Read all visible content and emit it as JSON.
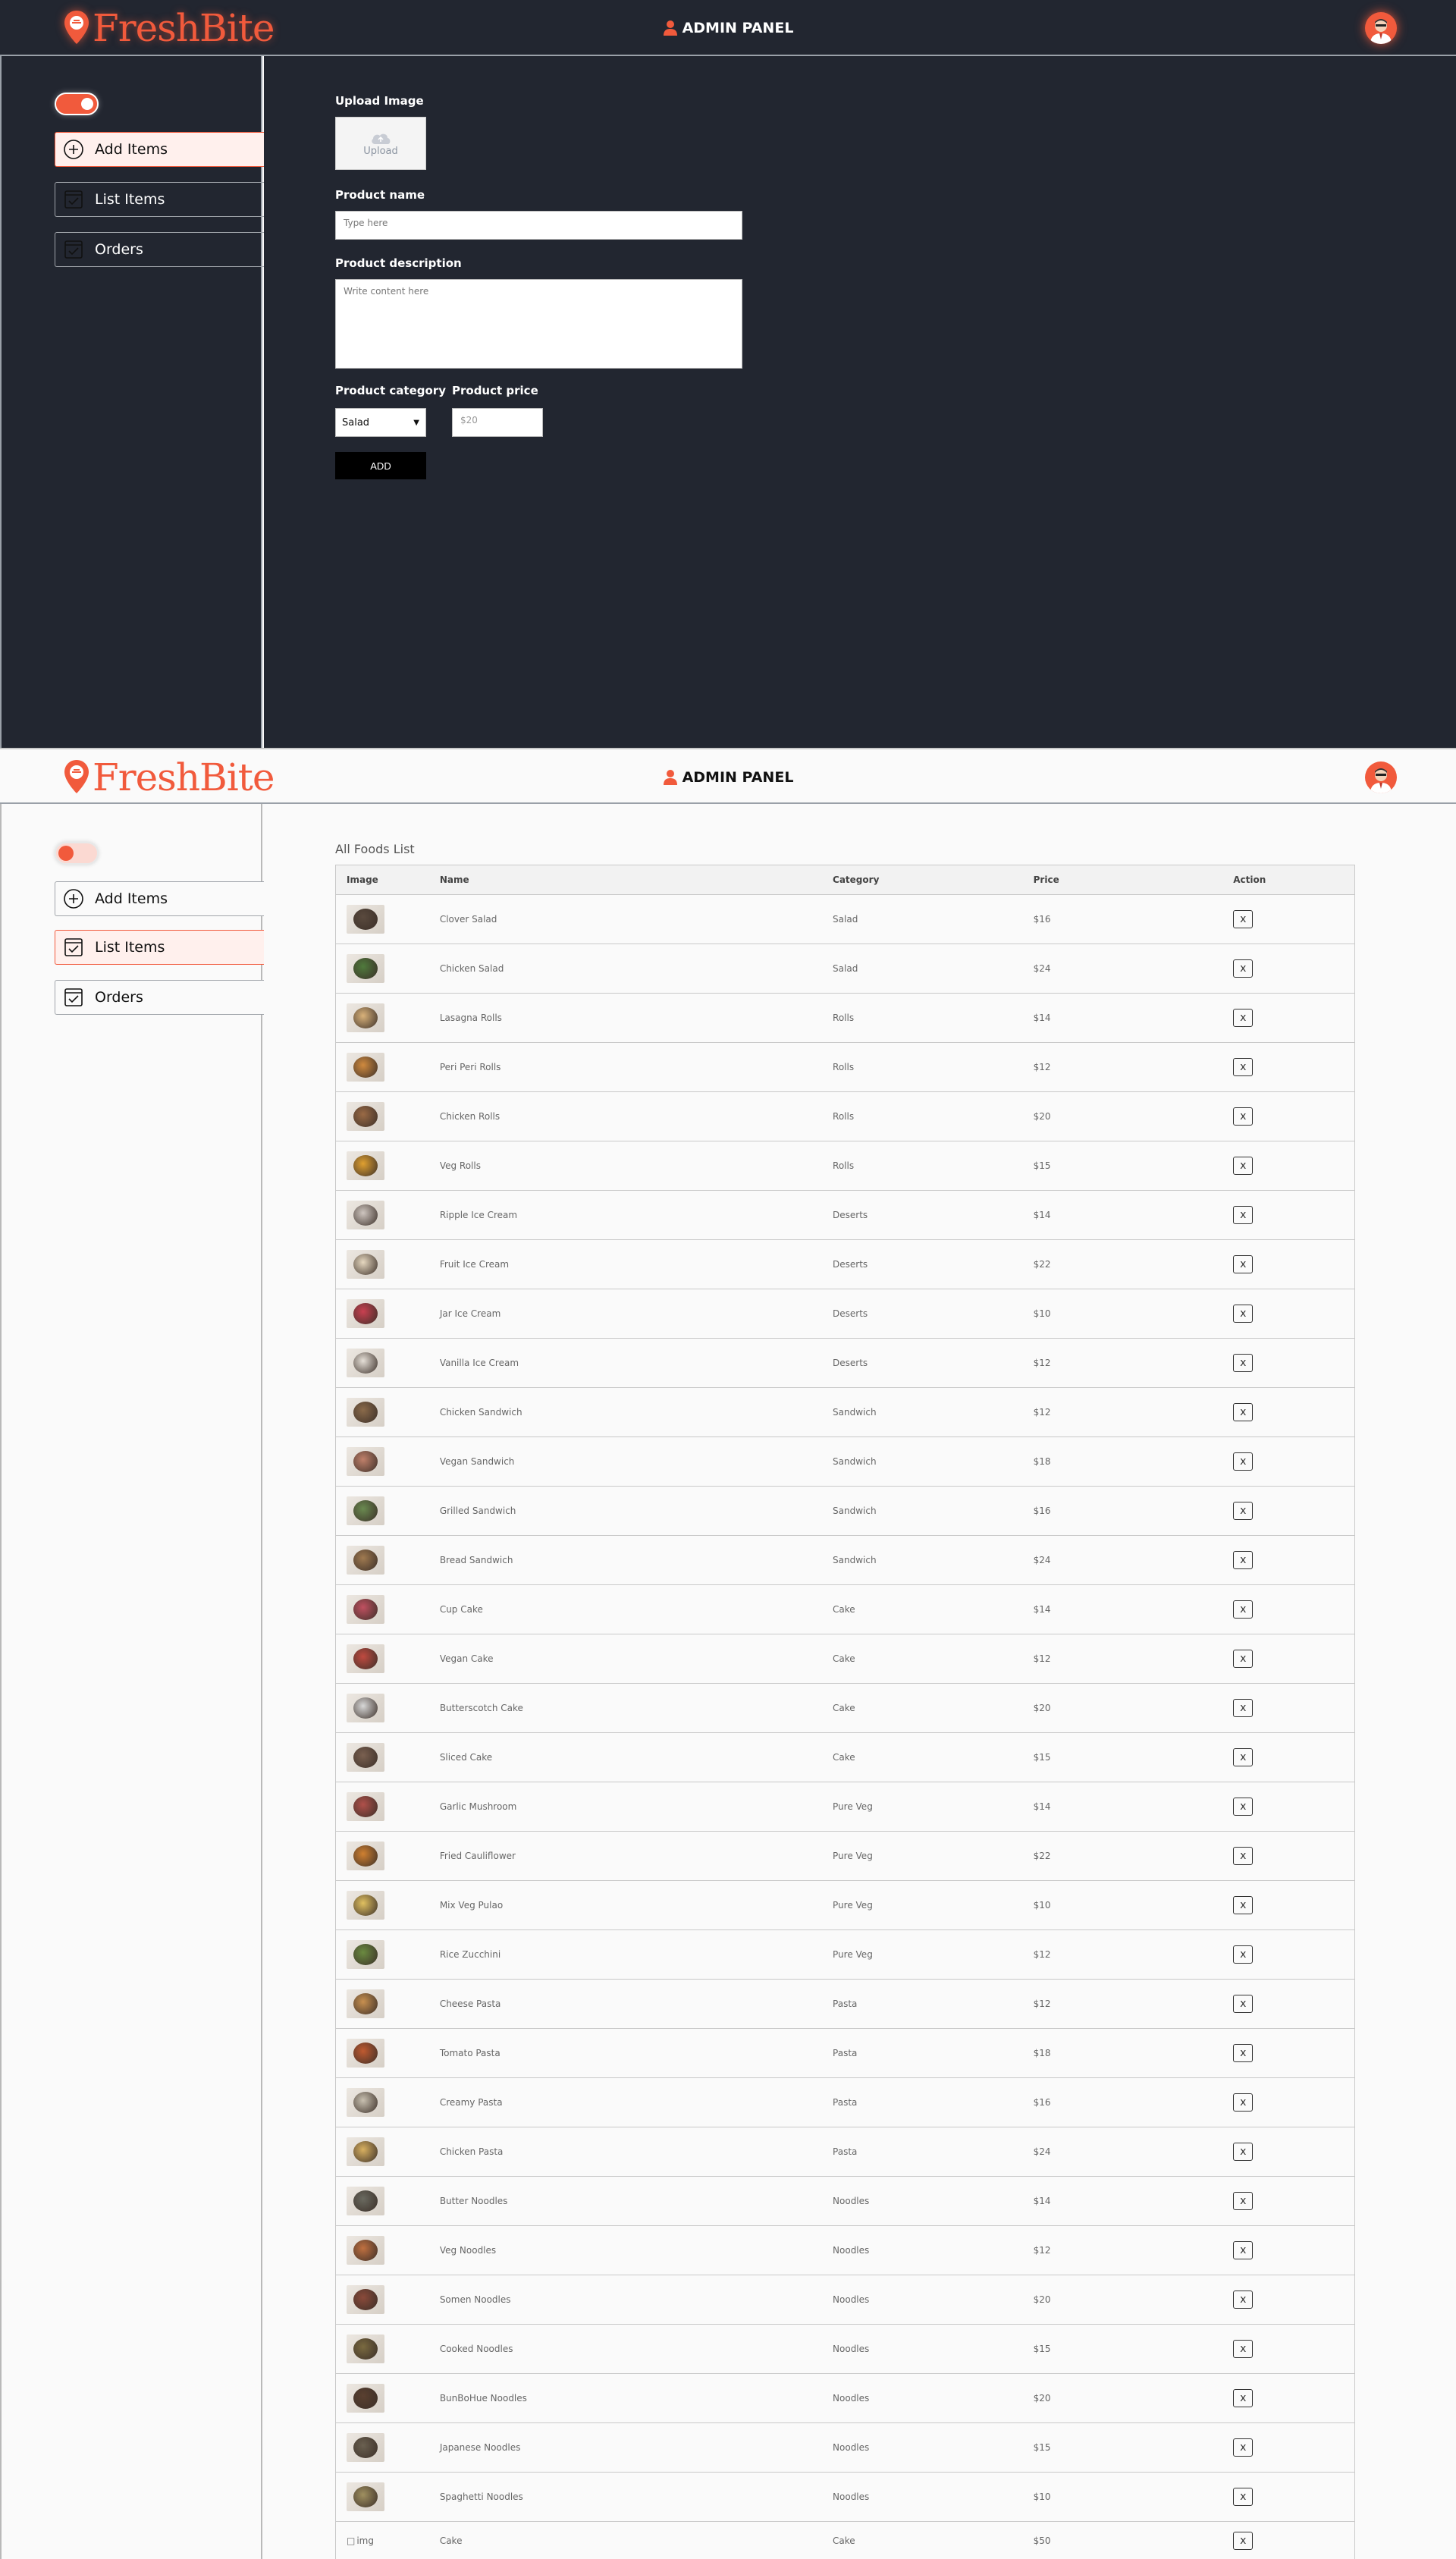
{
  "brand": {
    "name": "FreshBite",
    "accent": "#f15a3c"
  },
  "header": {
    "title": "ADMIN PANEL"
  },
  "sidebar": {
    "items": [
      {
        "label": "Add Items"
      },
      {
        "label": "List Items"
      },
      {
        "label": "Orders"
      }
    ]
  },
  "add_form": {
    "upload_label": "Upload Image",
    "upload_text": "Upload",
    "name_label": "Product name",
    "name_placeholder": "Type here",
    "desc_label": "Product description",
    "desc_placeholder": "Write content here",
    "category_label": "Product category",
    "category_value": "Salad",
    "price_label": "Product price",
    "price_placeholder": "$20",
    "add_button": "ADD"
  },
  "list": {
    "title": "All Foods List",
    "columns": [
      "Image",
      "Name",
      "Category",
      "Price",
      "Action"
    ],
    "action_label": "x",
    "items": [
      {
        "name": "Clover Salad",
        "category": "Salad",
        "price": "$16",
        "tone": "#5a4a3e"
      },
      {
        "name": "Chicken Salad",
        "category": "Salad",
        "price": "$24",
        "tone": "#4f7a3c"
      },
      {
        "name": "Lasagna Rolls",
        "category": "Rolls",
        "price": "$14",
        "tone": "#d9b27a"
      },
      {
        "name": "Peri Peri Rolls",
        "category": "Rolls",
        "price": "$12",
        "tone": "#d08a3e"
      },
      {
        "name": "Chicken Rolls",
        "category": "Rolls",
        "price": "$20",
        "tone": "#9a6a45"
      },
      {
        "name": "Veg Rolls",
        "category": "Rolls",
        "price": "$15",
        "tone": "#e0a030"
      },
      {
        "name": "Ripple Ice Cream",
        "category": "Deserts",
        "price": "$14",
        "tone": "#cfc6c0"
      },
      {
        "name": "Fruit Ice Cream",
        "category": "Deserts",
        "price": "$22",
        "tone": "#e6d8c0"
      },
      {
        "name": "Jar Ice Cream",
        "category": "Deserts",
        "price": "$10",
        "tone": "#c94050"
      },
      {
        "name": "Vanilla Ice Cream",
        "category": "Deserts",
        "price": "$12",
        "tone": "#e6e0d8"
      },
      {
        "name": "Chicken Sandwich",
        "category": "Sandwich",
        "price": "$12",
        "tone": "#8a6a4a"
      },
      {
        "name": "Vegan Sandwich",
        "category": "Sandwich",
        "price": "$18",
        "tone": "#c0806a"
      },
      {
        "name": "Grilled Sandwich",
        "category": "Sandwich",
        "price": "$16",
        "tone": "#6a8a50"
      },
      {
        "name": "Bread Sandwich",
        "category": "Sandwich",
        "price": "$24",
        "tone": "#a07a50"
      },
      {
        "name": "Cup Cake",
        "category": "Cake",
        "price": "$14",
        "tone": "#c05060"
      },
      {
        "name": "Vegan Cake",
        "category": "Cake",
        "price": "$12",
        "tone": "#c04a40"
      },
      {
        "name": "Butterscotch Cake",
        "category": "Cake",
        "price": "$20",
        "tone": "#d8d8d8"
      },
      {
        "name": "Sliced Cake",
        "category": "Cake",
        "price": "$15",
        "tone": "#7a6050"
      },
      {
        "name": "Garlic Mushroom",
        "category": "Pure Veg",
        "price": "$14",
        "tone": "#b0504a"
      },
      {
        "name": "Fried Cauliflower",
        "category": "Pure Veg",
        "price": "$22",
        "tone": "#d08030"
      },
      {
        "name": "Mix Veg Pulao",
        "category": "Pure Veg",
        "price": "$10",
        "tone": "#e0c060"
      },
      {
        "name": "Rice Zucchini",
        "category": "Pure Veg",
        "price": "$12",
        "tone": "#6a8a40"
      },
      {
        "name": "Cheese Pasta",
        "category": "Pasta",
        "price": "$12",
        "tone": "#c89050"
      },
      {
        "name": "Tomato Pasta",
        "category": "Pasta",
        "price": "$18",
        "tone": "#c05a30"
      },
      {
        "name": "Creamy Pasta",
        "category": "Pasta",
        "price": "$16",
        "tone": "#c8c0b0"
      },
      {
        "name": "Chicken Pasta",
        "category": "Pasta",
        "price": "$24",
        "tone": "#d8b060"
      },
      {
        "name": "Butter Noodles",
        "category": "Noodles",
        "price": "$14",
        "tone": "#6a6a60"
      },
      {
        "name": "Veg Noodles",
        "category": "Noodles",
        "price": "$12",
        "tone": "#c07040"
      },
      {
        "name": "Somen Noodles",
        "category": "Noodles",
        "price": "$20",
        "tone": "#8a4a3a"
      },
      {
        "name": "Cooked Noodles",
        "category": "Noodles",
        "price": "$15",
        "tone": "#7a6a40"
      },
      {
        "name": "BunBoHue Noodles",
        "category": "Noodles",
        "price": "$20",
        "tone": "#5a4030"
      },
      {
        "name": "Japanese Noodles",
        "category": "Noodles",
        "price": "$15",
        "tone": "#6a6050"
      },
      {
        "name": "Spaghetti Noodles",
        "category": "Noodles",
        "price": "$10",
        "tone": "#a09060"
      },
      {
        "name": "Cake",
        "category": "Cake",
        "price": "$50",
        "tone": "",
        "broken": true,
        "alt": "img"
      }
    ]
  }
}
